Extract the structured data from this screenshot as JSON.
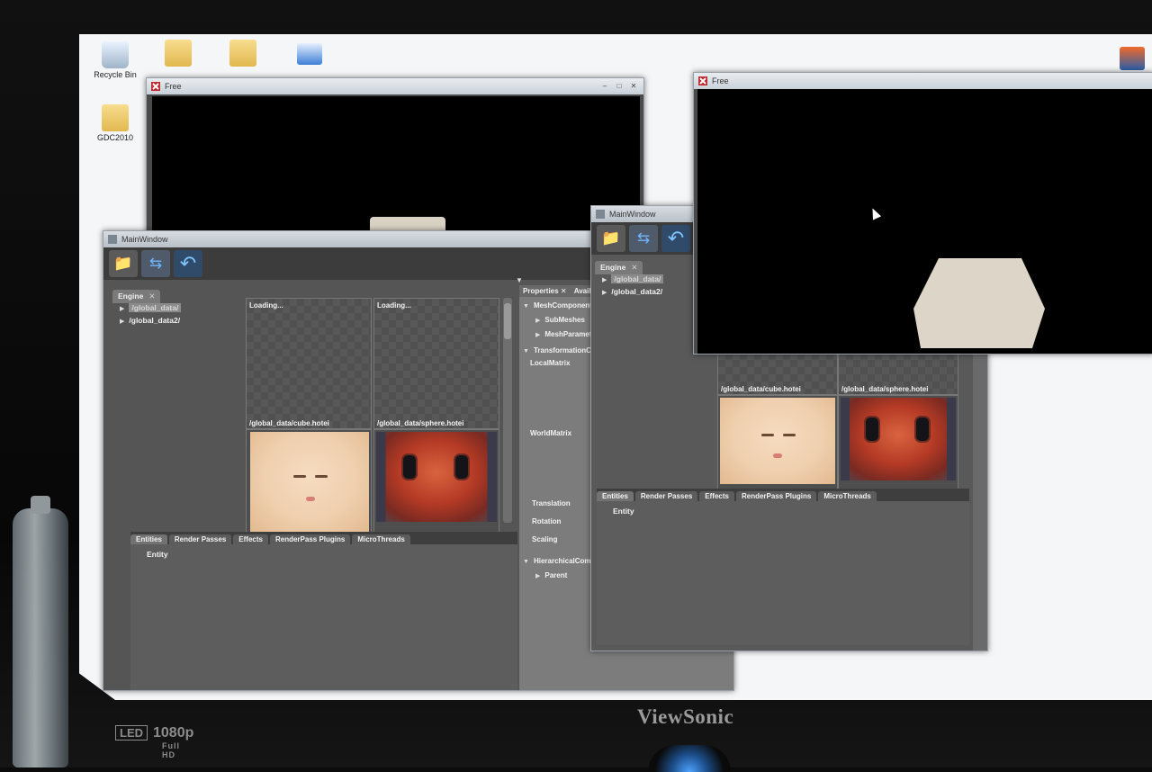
{
  "desktop": {
    "icons": [
      {
        "label": "Recycle Bin",
        "icon": "recycle-bin-icon"
      },
      {
        "label": "",
        "icon": "folder-icon"
      },
      {
        "label": "",
        "icon": "folder-shortcut-icon"
      },
      {
        "label": "",
        "icon": "computer-shortcut-icon"
      },
      {
        "label": "GDC2010",
        "icon": "folder-icon"
      }
    ]
  },
  "free_window_back": {
    "title": "Free"
  },
  "free_window_front": {
    "title": "Free"
  },
  "main_window_left": {
    "title": "MainWindow",
    "engine_tab": "Engine",
    "tree": [
      "/global_data/",
      "/global_data2/"
    ],
    "assets": [
      {
        "label": "Loading..."
      },
      {
        "label": "Loading..."
      },
      {
        "label": "/global_data/cube.hotei"
      },
      {
        "label": "/global_data/sphere.hotei"
      }
    ],
    "properties_tabs": [
      "Properties",
      "Avail"
    ],
    "properties": {
      "mesh_component": "MeshComponent",
      "submeshes": "SubMeshes",
      "mesh_params": "MeshParamet..",
      "transformation": "TransformationCo",
      "local_matrix": "LocalMatrix",
      "world_matrix": "WorldMatrix",
      "translation": "Translation",
      "rotation": "Rotation",
      "scaling": "Scaling",
      "hierarchical": "HierarchicalComp",
      "parent": "Parent"
    },
    "bottom_tabs": [
      "Entities",
      "Render Passes",
      "Effects",
      "RenderPass Plugins",
      "MicroThreads"
    ],
    "entity_row": "Entity"
  },
  "main_window_right": {
    "title": "MainWindow",
    "engine_tab": "Engine",
    "tree": [
      "/global_data/",
      "/global_data2/"
    ],
    "assets": [
      {
        "label": "/global_data/cube.hotei"
      },
      {
        "label": "/global_data/sphere.hotei"
      }
    ],
    "bottom_tabs": [
      "Entities",
      "Render Passes",
      "Effects",
      "RenderPass Plugins",
      "MicroThreads"
    ],
    "entity_row": "Entity"
  },
  "monitor": {
    "brand": "ViewSonic",
    "led": "LED",
    "resolution": "1080p",
    "resolution_sub": "Full HD"
  }
}
